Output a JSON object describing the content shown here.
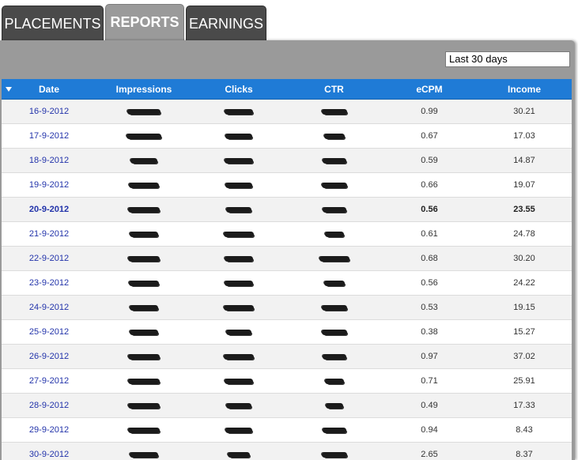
{
  "tabs": [
    {
      "label": "PLACEMENTS",
      "active": false
    },
    {
      "label": "REPORTS",
      "active": true
    },
    {
      "label": "EARNINGS",
      "active": false
    }
  ],
  "range_select": {
    "value": "Last 30 days"
  },
  "table": {
    "columns": [
      "Date",
      "Impressions",
      "Clicks",
      "CTR",
      "eCPM",
      "Income"
    ],
    "rows": [
      {
        "date": "16-9-2012",
        "ecpm": "0.99",
        "income": "30.21"
      },
      {
        "date": "17-9-2012",
        "ecpm": "0.67",
        "income": "17.03"
      },
      {
        "date": "18-9-2012",
        "ecpm": "0.59",
        "income": "14.87"
      },
      {
        "date": "19-9-2012",
        "ecpm": "0.66",
        "income": "19.07"
      },
      {
        "date": "20-9-2012",
        "ecpm": "0.56",
        "income": "23.55"
      },
      {
        "date": "21-9-2012",
        "ecpm": "0.61",
        "income": "24.78"
      },
      {
        "date": "22-9-2012",
        "ecpm": "0.68",
        "income": "30.20"
      },
      {
        "date": "23-9-2012",
        "ecpm": "0.56",
        "income": "24.22"
      },
      {
        "date": "24-9-2012",
        "ecpm": "0.53",
        "income": "19.15"
      },
      {
        "date": "25-9-2012",
        "ecpm": "0.38",
        "income": "15.27"
      },
      {
        "date": "26-9-2012",
        "ecpm": "0.97",
        "income": "37.02"
      },
      {
        "date": "27-9-2012",
        "ecpm": "0.71",
        "income": "25.91"
      },
      {
        "date": "28-9-2012",
        "ecpm": "0.49",
        "income": "17.33"
      },
      {
        "date": "29-9-2012",
        "ecpm": "0.94",
        "income": "8.43"
      },
      {
        "date": "30-9-2012",
        "ecpm": "2.65",
        "income": "8.37"
      }
    ]
  },
  "colors": {
    "header_blue": "#1f7bd6",
    "panel_grey": "#9a9a9a",
    "tab_dark": "#4a4a4a",
    "date_link": "#2233aa"
  }
}
